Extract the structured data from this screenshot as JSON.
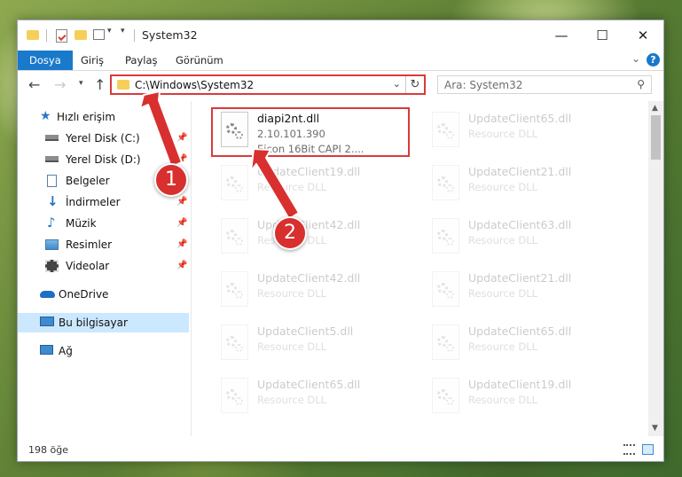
{
  "window": {
    "title": "System32",
    "controls": {
      "minimize": "—",
      "maximize": "☐",
      "close": "✕"
    }
  },
  "ribbon": {
    "tabs": [
      "Dosya",
      "Giriş",
      "Paylaş",
      "Görünüm"
    ],
    "help": "?"
  },
  "address": {
    "path": "C:\\Windows\\System32",
    "search_placeholder": "Ara: System32"
  },
  "sidebar": {
    "items": [
      {
        "label": "Hızlı erişim",
        "icon": "star-icon",
        "pinned": false
      },
      {
        "label": "Yerel Disk (C:)",
        "icon": "drive-icon",
        "pinned": true
      },
      {
        "label": "Yerel Disk (D:)",
        "icon": "drive-icon",
        "pinned": true
      },
      {
        "label": "Belgeler",
        "icon": "documents-icon",
        "pinned": true
      },
      {
        "label": "İndirmeler",
        "icon": "download-icon",
        "pinned": true
      },
      {
        "label": "Müzik",
        "icon": "music-icon",
        "pinned": true
      },
      {
        "label": "Resimler",
        "icon": "pictures-icon",
        "pinned": true
      },
      {
        "label": "Videolar",
        "icon": "video-icon",
        "pinned": true
      },
      {
        "label": "OneDrive",
        "icon": "cloud-icon",
        "pinned": false
      },
      {
        "label": "Bu bilgisayar",
        "icon": "computer-icon",
        "pinned": false,
        "selected": true
      },
      {
        "label": "Ağ",
        "icon": "network-icon",
        "pinned": false
      }
    ]
  },
  "files": [
    {
      "name": "diapi2nt.dll",
      "line2": "2.10.101.390",
      "line3": "Eicon 16Bit CAPI 2....",
      "highlighted": true
    },
    {
      "name": "UpdateClient65.dll",
      "line2": "Resource DLL"
    },
    {
      "name": "UpdateClient19.dll",
      "line2": "Resource DLL"
    },
    {
      "name": "UpdateClient21.dll",
      "line2": "Resource DLL"
    },
    {
      "name": "UpdateClient42.dll",
      "line2": "Resource DLL"
    },
    {
      "name": "UpdateClient63.dll",
      "line2": "Resource DLL"
    },
    {
      "name": "UpdateClient42.dll",
      "line2": "Resource DLL"
    },
    {
      "name": "UpdateClient21.dll",
      "line2": "Resource DLL"
    },
    {
      "name": "UpdateClient5.dll",
      "line2": "Resource DLL"
    },
    {
      "name": "UpdateClient65.dll",
      "line2": "Resource DLL"
    },
    {
      "name": "UpdateClient65.dll",
      "line2": "Resource DLL"
    },
    {
      "name": "UpdateClient19.dll",
      "line2": "Resource DLL"
    }
  ],
  "status": {
    "count": "198 öğe"
  },
  "callouts": [
    "1",
    "2"
  ],
  "colors": {
    "accent": "#1979ca",
    "highlight": "#d93a3a",
    "selected": "#cce8ff"
  }
}
